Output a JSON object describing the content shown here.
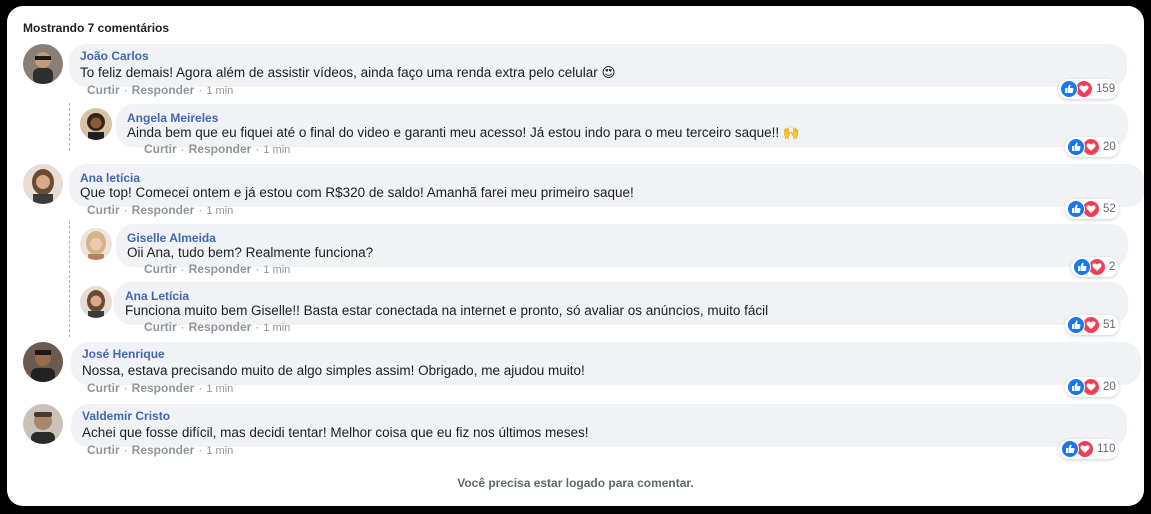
{
  "header": {
    "title": "Mostrando 7 comentários"
  },
  "actions": {
    "like": "Curtir",
    "reply": "Responder",
    "separator": "·"
  },
  "colors": {
    "author": "#4267b2",
    "like": "#1877f2",
    "love": "#f33e58",
    "bubble": "#f0f2f5"
  },
  "comments": [
    {
      "author": "João Carlos",
      "text": "To feliz demais! Agora além de assistir vídeos, ainda faço uma renda extra pelo celular 😍",
      "time": "1 min",
      "reactions": "159",
      "reply": false
    },
    {
      "author": "Angela Meireles",
      "text": "Ainda bem que eu fiquei até o final do video e garanti meu acesso! Já estou indo para o meu terceiro saque!! 🙌",
      "time": "1 min",
      "reactions": "20",
      "reply": true
    },
    {
      "author": "Ana letícia",
      "text": "Que top! Comecei ontem e já estou com R$320 de saldo! Amanhã farei meu primeiro saque!",
      "time": "1 min",
      "reactions": "52",
      "reply": false
    },
    {
      "author": "Giselle Almeida",
      "text": "Oii Ana, tudo bem? Realmente funciona?",
      "time": "1 min",
      "reactions": "2",
      "reply": true
    },
    {
      "author": "Ana Letícia",
      "text": "Funciona muito bem Giselle!! Basta estar conectada na internet e pronto, só avaliar os anúncios, muito fácil",
      "time": "1 min",
      "reactions": "51",
      "reply": true
    },
    {
      "author": "José Henrique",
      "text": "Nossa, estava precisando muito de algo simples assim! Obrigado, me ajudou muito!",
      "time": "1 min",
      "reactions": "20",
      "reply": false
    },
    {
      "author": "Valdemir Cristo",
      "text": "Achei que fosse difícil, mas decidi tentar! Melhor coisa que eu fiz nos últimos meses!",
      "time": "1 min",
      "reactions": "110",
      "reply": false
    }
  ],
  "footer": {
    "text": "Você precisa estar logado para comentar."
  }
}
